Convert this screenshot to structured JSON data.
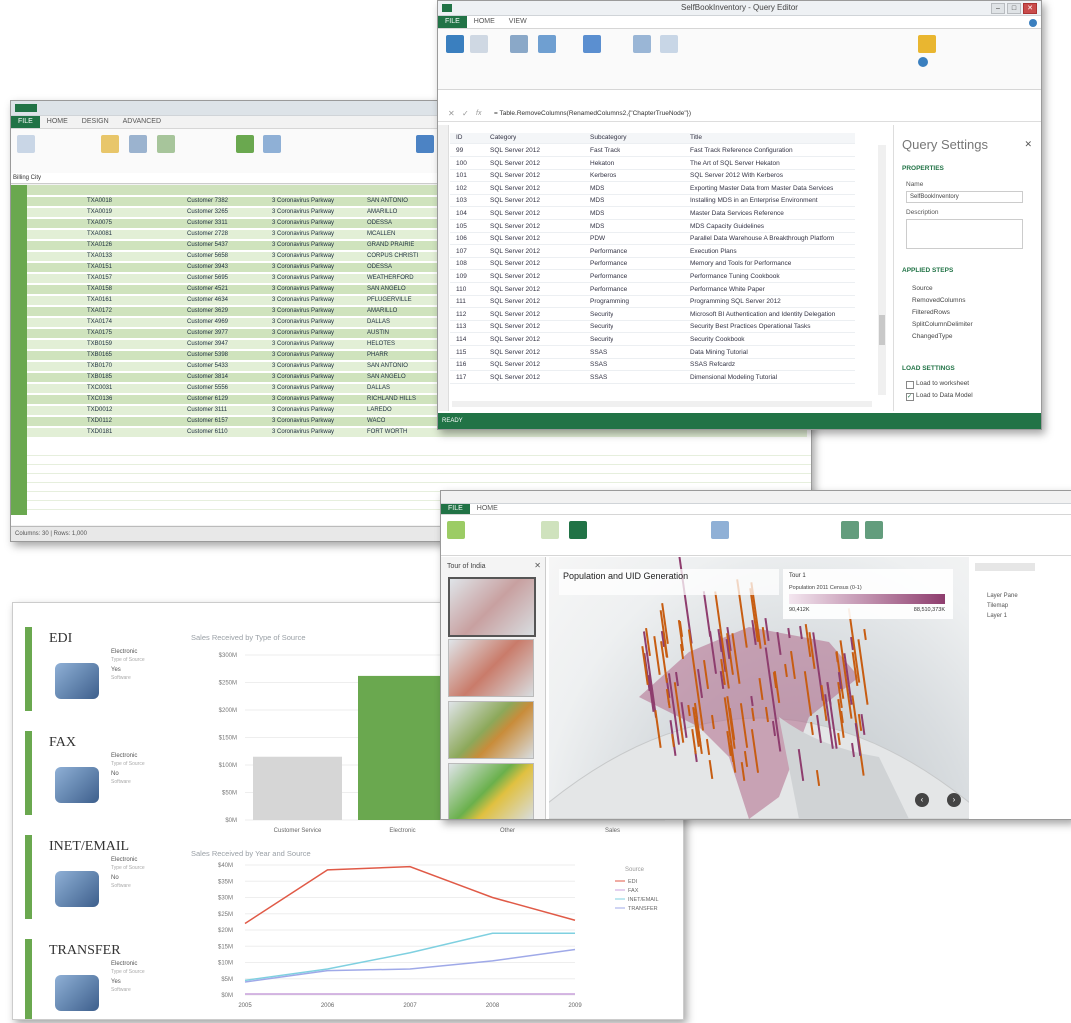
{
  "excel": {
    "tabs": [
      "HOME",
      "DESIGN",
      "ADVANCED"
    ],
    "name_box": "Billing City",
    "rows": [
      {
        "id": "TXA0018",
        "name": "Customer 7382",
        "addr": "3 Coronavirus Parkway",
        "city": "SAN ANTONIO"
      },
      {
        "id": "TXA0019",
        "name": "Customer 3265",
        "addr": "3 Coronavirus Parkway",
        "city": "AMARILLO"
      },
      {
        "id": "TXA0075",
        "name": "Customer 3311",
        "addr": "3 Coronavirus Parkway",
        "city": "ODESSA"
      },
      {
        "id": "TXA0081",
        "name": "Customer 2728",
        "addr": "3 Coronavirus Parkway",
        "city": "MCALLEN"
      },
      {
        "id": "TXA0126",
        "name": "Customer 5437",
        "addr": "3 Coronavirus Parkway",
        "city": "GRAND PRAIRIE"
      },
      {
        "id": "TXA0133",
        "name": "Customer 5658",
        "addr": "3 Coronavirus Parkway",
        "city": "CORPUS CHRISTI"
      },
      {
        "id": "TXA0151",
        "name": "Customer 3943",
        "addr": "3 Coronavirus Parkway",
        "city": "ODESSA"
      },
      {
        "id": "TXA0157",
        "name": "Customer 5695",
        "addr": "3 Coronavirus Parkway",
        "city": "WEATHERFORD"
      },
      {
        "id": "TXA0158",
        "name": "Customer 4521",
        "addr": "3 Coronavirus Parkway",
        "city": "SAN ANGELO"
      },
      {
        "id": "TXA0161",
        "name": "Customer 4634",
        "addr": "3 Coronavirus Parkway",
        "city": "PFLUGERVILLE"
      },
      {
        "id": "TXA0172",
        "name": "Customer 3629",
        "addr": "3 Coronavirus Parkway",
        "city": "AMARILLO"
      },
      {
        "id": "TXA0174",
        "name": "Customer 4969",
        "addr": "3 Coronavirus Parkway",
        "city": "DALLAS"
      },
      {
        "id": "TXA0175",
        "name": "Customer 3977",
        "addr": "3 Coronavirus Parkway",
        "city": "AUSTIN"
      },
      {
        "id": "TXB0159",
        "name": "Customer 3947",
        "addr": "3 Coronavirus Parkway",
        "city": "HELOTES"
      },
      {
        "id": "TXB0165",
        "name": "Customer 5398",
        "addr": "3 Coronavirus Parkway",
        "city": "PHARR"
      },
      {
        "id": "TXB0170",
        "name": "Customer 5433",
        "addr": "3 Coronavirus Parkway",
        "city": "SAN ANTONIO"
      },
      {
        "id": "TXB0185",
        "name": "Customer 3814",
        "addr": "3 Coronavirus Parkway",
        "city": "SAN ANGELO"
      },
      {
        "id": "TXC0031",
        "name": "Customer 5556",
        "addr": "3 Coronavirus Parkway",
        "city": "DALLAS"
      },
      {
        "id": "TXC0136",
        "name": "Customer 6129",
        "addr": "3 Coronavirus Parkway",
        "city": "RICHLAND HILLS"
      },
      {
        "id": "TXD0012",
        "name": "Customer 3111",
        "addr": "3 Coronavirus Parkway",
        "city": "LAREDO"
      },
      {
        "id": "TXD0112",
        "name": "Customer 6157",
        "addr": "3 Coronavirus Parkway",
        "city": "WACO"
      },
      {
        "id": "TXD0181",
        "name": "Customer 6110",
        "addr": "3 Coronavirus Parkway",
        "city": "FORT WORTH"
      }
    ],
    "status": "Columns: 30 | Rows: 1,000"
  },
  "query_editor": {
    "title": "SelfBookInventory - Query Editor",
    "tabs": [
      "FILE",
      "HOME",
      "VIEW"
    ],
    "formula": "= Table.RemoveColumns(RenamedColumns2,{\"ChapterTrueNode\"})",
    "columns": [
      "ID",
      "Category",
      "Subcategory",
      "Title"
    ],
    "rows": [
      [
        "99",
        "SQL Server 2012",
        "Fast Track",
        "Fast Track Reference Configuration"
      ],
      [
        "100",
        "SQL Server 2012",
        "Hekaton",
        "The Art of SQL Server Hekaton"
      ],
      [
        "101",
        "SQL Server 2012",
        "Kerberos",
        "SQL Server 2012 With Kerberos"
      ],
      [
        "102",
        "SQL Server 2012",
        "MDS",
        "Exporting Master Data from Master Data Services"
      ],
      [
        "103",
        "SQL Server 2012",
        "MDS",
        "Installing MDS in an Enterprise Environment"
      ],
      [
        "104",
        "SQL Server 2012",
        "MDS",
        "Master Data Services Reference"
      ],
      [
        "105",
        "SQL Server 2012",
        "MDS",
        "MDS Capacity Guidelines"
      ],
      [
        "106",
        "SQL Server 2012",
        "PDW",
        "Parallel Data Warehouse A Breakthrough Platform"
      ],
      [
        "107",
        "SQL Server 2012",
        "Performance",
        "Execution Plans"
      ],
      [
        "108",
        "SQL Server 2012",
        "Performance",
        "Memory and Tools for Performance"
      ],
      [
        "109",
        "SQL Server 2012",
        "Performance",
        "Performance Tuning Cookbook"
      ],
      [
        "110",
        "SQL Server 2012",
        "Performance",
        "Performance White Paper"
      ],
      [
        "111",
        "SQL Server 2012",
        "Programming",
        "Programming SQL Server 2012"
      ],
      [
        "112",
        "SQL Server 2012",
        "Security",
        "Microsoft BI Authentication and Identity Delegation"
      ],
      [
        "113",
        "SQL Server 2012",
        "Security",
        "Security Best Practices Operational Tasks"
      ],
      [
        "114",
        "SQL Server 2012",
        "Security",
        "Security Cookbook"
      ],
      [
        "115",
        "SQL Server 2012",
        "SSAS",
        "Data Mining Tutorial"
      ],
      [
        "116",
        "SQL Server 2012",
        "SSAS",
        "SSAS Refcardz"
      ],
      [
        "117",
        "SQL Server 2012",
        "SSAS",
        "Dimensional Modeling Tutorial"
      ]
    ],
    "settings_title": "Query Settings",
    "properties": "PROPERTIES",
    "name_label": "Name",
    "name_value": "SelfBookInventory",
    "description_label": "Description",
    "applied_steps": "APPLIED STEPS",
    "steps": [
      "Source",
      "RemovedColumns",
      "FilteredRows",
      "SplitColumnDelimiter",
      "ChangedType"
    ],
    "load_settings": "LOAD SETTINGS",
    "load_ws": "Load to worksheet",
    "load_dm": "Load to Data Model",
    "status": "READY"
  },
  "dashboard": {
    "cards": [
      {
        "name": "EDI",
        "l1": "Electronic",
        "l2": "Type of Source",
        "l3": "Yes",
        "l4": "Software"
      },
      {
        "name": "FAX",
        "l1": "Electronic",
        "l2": "Type of Source",
        "l3": "No",
        "l4": "Software"
      },
      {
        "name": "INET/EMAIL",
        "l1": "Electronic",
        "l2": "Type of Source",
        "l3": "No",
        "l4": "Software"
      },
      {
        "name": "TRANSFER",
        "l1": "Electronic",
        "l2": "Type of Source",
        "l3": "Yes",
        "l4": "Software"
      }
    ],
    "bar_title": "Sales Received by Type of Source",
    "line_title": "Sales Received by Year and Source",
    "legend_title": "Source",
    "colors": {
      "edi": "#e05a47",
      "fax": "#c9a0dc",
      "inet": "#7fd0e0",
      "transfer": "#9fa9e8",
      "bar_grey": "#d6d6d6",
      "bar_green": "#6aa84f"
    }
  },
  "chart_data": [
    {
      "type": "bar",
      "title": "Sales Received by Type of Source",
      "categories": [
        "Customer Service",
        "Electronic",
        "Other",
        "Sales"
      ],
      "values": [
        115,
        262,
        0,
        0
      ],
      "yticks": [
        "$0M",
        "$50M",
        "$100M",
        "$150M",
        "$200M",
        "$250M",
        "$300M"
      ],
      "ylim": [
        0,
        300
      ]
    },
    {
      "type": "line",
      "title": "Sales Received by Year and Source",
      "x": [
        "2005",
        "2006",
        "2007",
        "2008",
        "2009"
      ],
      "yticks": [
        "$0M",
        "$5M",
        "$10M",
        "$15M",
        "$20M",
        "$25M",
        "$30M",
        "$35M",
        "$40M"
      ],
      "ylim": [
        0,
        40
      ],
      "series": [
        {
          "name": "EDI",
          "values": [
            22,
            38.5,
            39.5,
            30,
            23
          ]
        },
        {
          "name": "FAX",
          "values": [
            0.3,
            0.3,
            0.3,
            0.3,
            0.3
          ]
        },
        {
          "name": "INET/EMAIL",
          "values": [
            4.5,
            8,
            13,
            19,
            19
          ]
        },
        {
          "name": "TRANSFER",
          "values": [
            4,
            7.5,
            8,
            10.5,
            14
          ]
        }
      ],
      "legend": "right"
    }
  ],
  "maps": {
    "tour_label": "Tour of India",
    "title": "Population and UID Generation",
    "legend_top": "Tour 1",
    "legend_sub": "Population 2011 Census (0-1)",
    "legend_min": "90,412K",
    "legend_max": "88,510,373K",
    "layer_items": [
      "Layer Pane",
      "Tilemap",
      "Layer 1"
    ]
  }
}
